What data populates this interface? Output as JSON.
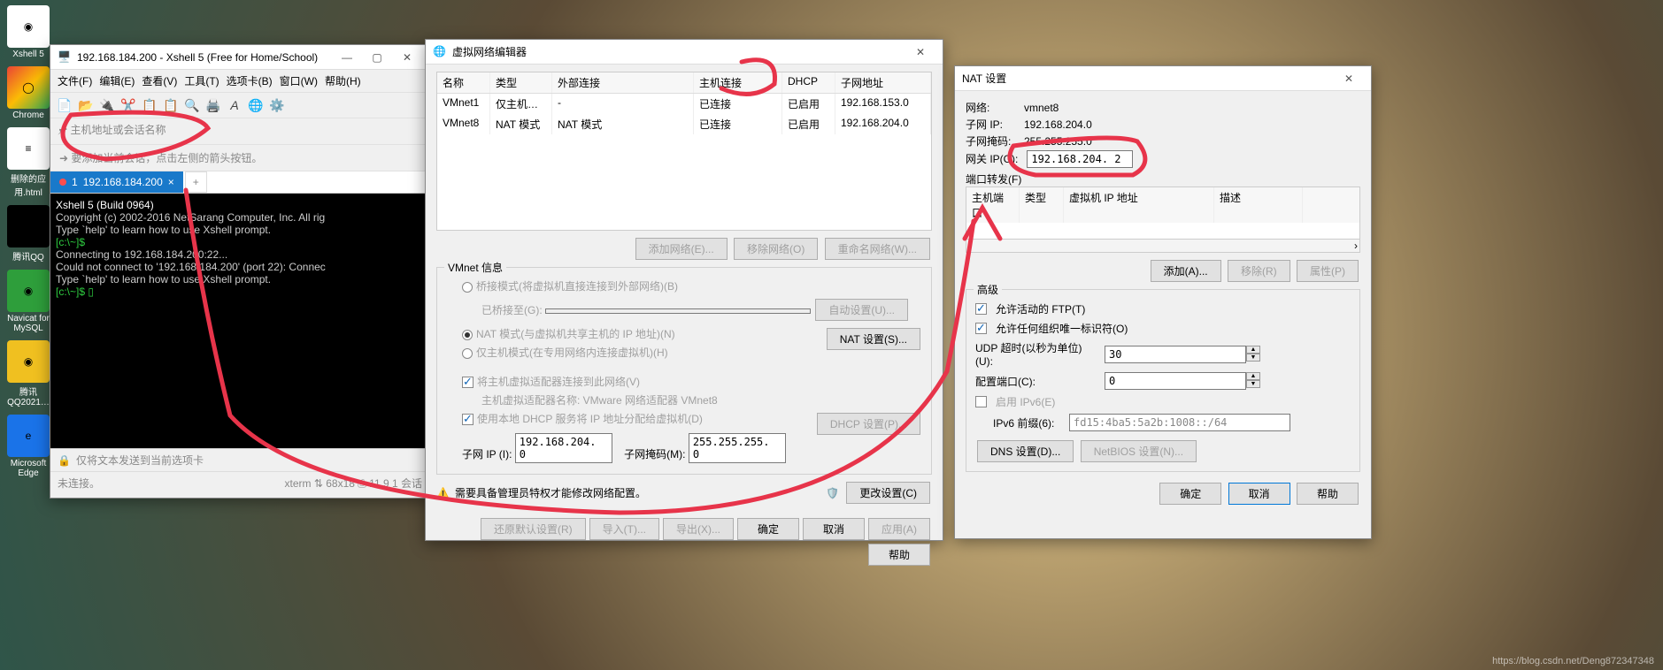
{
  "desktop": {
    "icons": [
      {
        "label": "Xshell 5",
        "glyph": "◉",
        "bg": "#fff"
      },
      {
        "label": "Chrome",
        "glyph": "◯",
        "bg": "linear-gradient(135deg,#ea4335,#fbbc05 50%,#34a853)"
      },
      {
        "label": "删除的应用.html",
        "glyph": "≡",
        "bg": "#fff"
      },
      {
        "label": "腾讯QQ",
        "glyph": "◉",
        "bg": "#000"
      },
      {
        "label": "Navicat for MySQL",
        "glyph": "◉",
        "bg": "#2e9e3b"
      },
      {
        "label": "腾讯QQ2021…",
        "glyph": "◉",
        "bg": "#f0c020"
      },
      {
        "label": "Microsoft Edge",
        "glyph": "e",
        "bg": "#1a73e8"
      }
    ]
  },
  "xshell": {
    "title": "192.168.184.200 - Xshell 5 (Free for Home/School)",
    "menu": [
      "文件(F)",
      "编辑(E)",
      "查看(V)",
      "工具(T)",
      "选项卡(B)",
      "窗口(W)",
      "帮助(H)"
    ],
    "path_hint": "主机地址或会话名称",
    "hint": "要添加当前会话，点击左侧的箭头按钮。",
    "tab_prefix": "1",
    "tab_label": "192.168.184.200",
    "term_lines": [
      {
        "cls": "w",
        "t": "Xshell 5 (Build 0964)"
      },
      {
        "cls": "",
        "t": "Copyright (c) 2002-2016 NetSarang Computer, Inc. All rig"
      },
      {
        "cls": "",
        "t": ""
      },
      {
        "cls": "",
        "t": "Type `help' to learn how to use Xshell prompt."
      },
      {
        "cls": "g",
        "t": "[c:\\~]$"
      },
      {
        "cls": "",
        "t": ""
      },
      {
        "cls": "",
        "t": "Connecting to 192.168.184.200:22..."
      },
      {
        "cls": "",
        "t": "Could not connect to '192.168.184.200' (port 22): Connec"
      },
      {
        "cls": "",
        "t": ""
      },
      {
        "cls": "",
        "t": "Type `help' to learn how to use Xshell prompt."
      },
      {
        "cls": "g",
        "t": "[c:\\~]$ ▯"
      }
    ],
    "footer1": "仅将文本发送到当前选项卡",
    "status_left": "未连接。",
    "status_right": [
      "xterm",
      "⇅ 68x18",
      "⎙ 11,9",
      "1 会话"
    ]
  },
  "vned": {
    "title": "虚拟网络编辑器",
    "cols": [
      "名称",
      "类型",
      "外部连接",
      "主机连接",
      "DHCP",
      "子网地址"
    ],
    "rows": [
      {
        "name": "VMnet1",
        "type": "仅主机…",
        "ext": "-",
        "host": "已连接",
        "dhcp": "已启用",
        "subnet": "192.168.153.0"
      },
      {
        "name": "VMnet8",
        "type": "NAT 模式",
        "ext": "NAT 模式",
        "host": "已连接",
        "dhcp": "已启用",
        "subnet": "192.168.204.0"
      }
    ],
    "btn_add": "添加网络(E)...",
    "btn_remove": "移除网络(O)",
    "btn_rename": "重命名网络(W)...",
    "info_title": "VMnet 信息",
    "r_bridge": "桥接模式(将虚拟机直接连接到外部网络)(B)",
    "bridge_to_label": "已桥接至(G):",
    "bridge_auto": "自动设置(U)...",
    "r_nat": "NAT 模式(与虚拟机共享主机的 IP 地址)(N)",
    "nat_settings": "NAT 设置(S)...",
    "r_host": "仅主机模式(在专用网络内连接虚拟机)(H)",
    "chk_hostadapter": "将主机虚拟适配器连接到此网络(V)",
    "hostadapter_name": "主机虚拟适配器名称: VMware 网络适配器 VMnet8",
    "chk_dhcp": "使用本地 DHCP 服务将 IP 地址分配给虚拟机(D)",
    "dhcp_settings": "DHCP 设置(P)...",
    "subnet_ip_label": "子网 IP (I):",
    "subnet_ip": "192.168.204. 0",
    "subnet_mask_label": "子网掩码(M):",
    "subnet_mask": "255.255.255. 0",
    "warn": "需要具备管理员特权才能修改网络配置。",
    "chg": "更改设置(C)",
    "btns": [
      "还原默认设置(R)",
      "导入(T)...",
      "导出(X)...",
      "确定",
      "取消",
      "应用(A)",
      "帮助"
    ]
  },
  "nat": {
    "title": "NAT 设置",
    "net_label": "网络:",
    "net": "vmnet8",
    "subip_label": "子网 IP:",
    "subip": "192.168.204.0",
    "mask_label": "子网掩码:",
    "mask": "255.255.255.0",
    "gw_label": "网关 IP(G):",
    "gw": "192.168.204. 2",
    "pf_title": "端口转发(F)",
    "pf_cols": [
      "主机端口",
      "类型",
      "虚拟机 IP 地址",
      "描述"
    ],
    "btn_add": "添加(A)...",
    "btn_remove": "移除(R)",
    "btn_prop": "属性(P)",
    "adv_title": "高级",
    "chk_ftp": "允许活动的 FTP(T)",
    "chk_org": "允许任何组织唯一标识符(O)",
    "udp_label": "UDP 超时(以秒为单位)(U):",
    "udp": "30",
    "port_label": "配置端口(C):",
    "port": "0",
    "chk_ipv6": "启用 IPv6(E)",
    "ipv6_label": "IPv6 前缀(6):",
    "ipv6": "fd15:4ba5:5a2b:1008::/64",
    "btn_dns": "DNS 设置(D)...",
    "btn_netbios": "NetBIOS 设置(N)...",
    "ok": "确定",
    "cancel": "取消",
    "help": "帮助"
  },
  "watermark": "https://blog.csdn.net/Deng872347348"
}
